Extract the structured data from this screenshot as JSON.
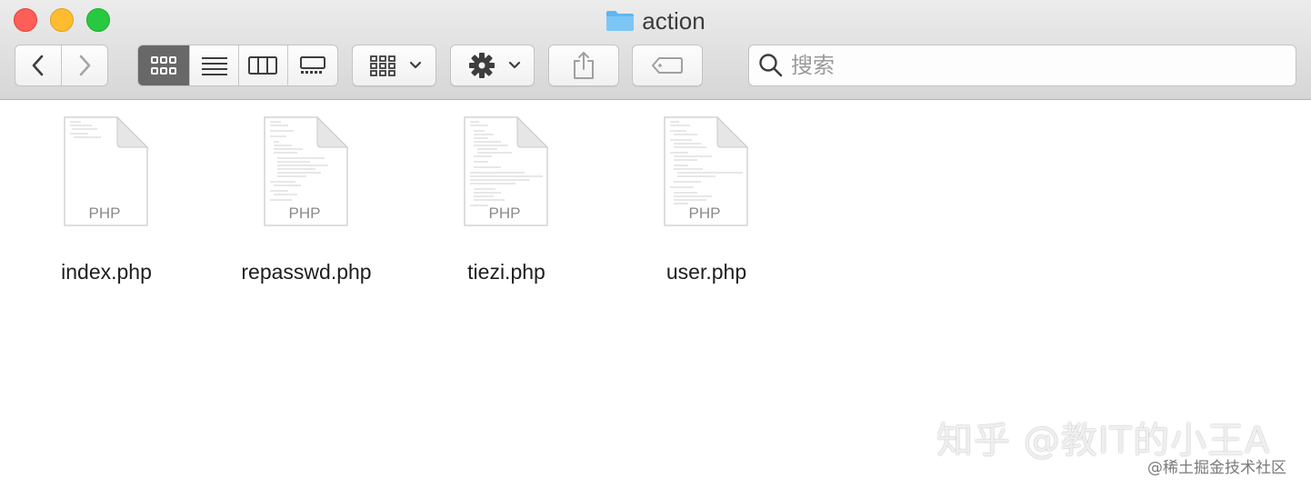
{
  "window": {
    "title": "action"
  },
  "toolbar": {
    "search_placeholder": "搜索",
    "icons": {
      "back": "chevron-left-icon",
      "forward": "chevron-right-icon",
      "view_icon": "grid-icon",
      "view_list": "list-icon",
      "view_columns": "columns-icon",
      "view_gallery": "gallery-icon",
      "group_by": "group-grid-icon",
      "action": "gear-icon",
      "share": "share-icon",
      "tags": "tag-icon",
      "search": "search-icon"
    }
  },
  "files": [
    {
      "name": "index.php",
      "type_label": "PHP"
    },
    {
      "name": "repasswd.php",
      "type_label": "PHP"
    },
    {
      "name": "tiezi.php",
      "type_label": "PHP"
    },
    {
      "name": "user.php",
      "type_label": "PHP"
    }
  ],
  "watermarks": {
    "main": "知乎 @教IT的小王A",
    "sub": "@稀土掘金技术社区"
  },
  "colors": {
    "close": "#fd5f57",
    "minimize": "#febc2e",
    "maximize": "#28c840",
    "folder": "#5fb6f0",
    "active_segment": "#686868"
  }
}
